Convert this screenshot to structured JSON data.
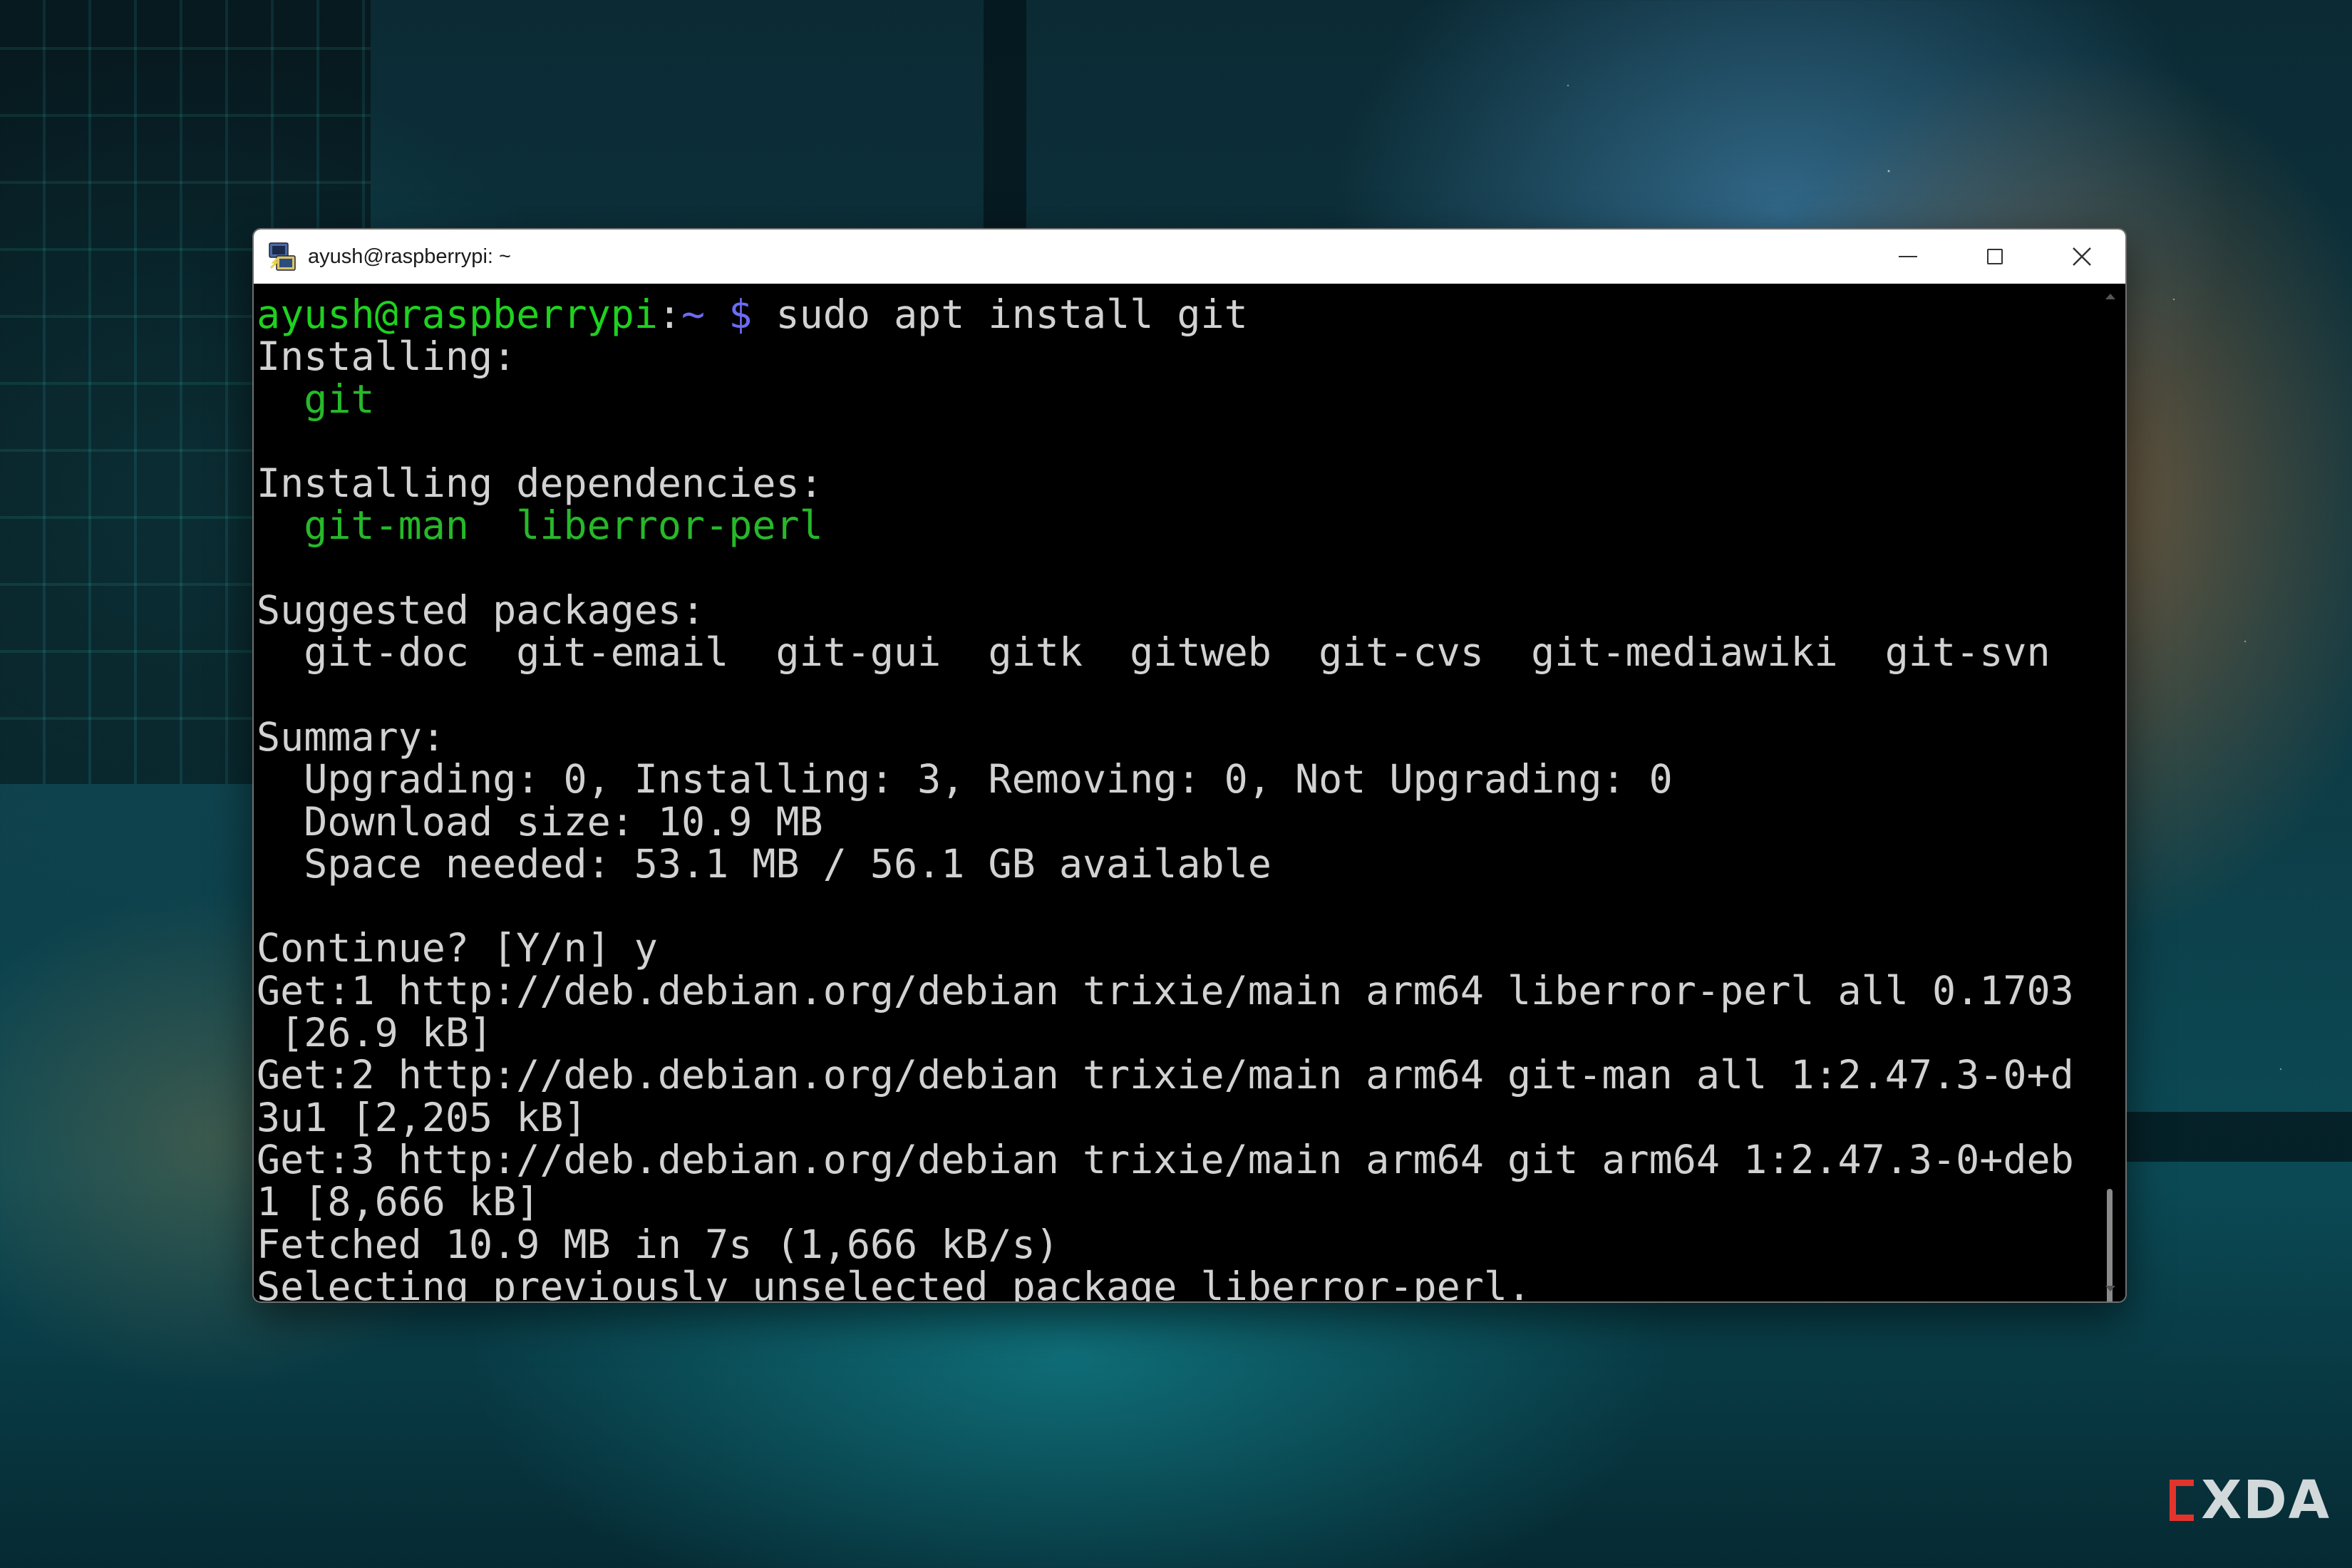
{
  "window": {
    "title": "ayush@raspberrypi: ~",
    "app_icon": "putty-terminal-icon"
  },
  "watermark": {
    "text": "XDA"
  },
  "terminal": {
    "prompt_user": "ayush@raspberrypi",
    "prompt_sep": ":",
    "prompt_path": "~ $",
    "command": " sudo apt install git",
    "lines": [
      "Installing:",
      "  ",
      "",
      "Installing dependencies:",
      "  ",
      "",
      "Suggested packages:",
      "  git-doc  git-email  git-gui  gitk  gitweb  git-cvs  git-mediawiki  git-svn",
      "",
      "Summary:",
      "  Upgrading: 0, Installing: 3, Removing: 0, Not Upgrading: 0",
      "  Download size: 10.9 MB",
      "  Space needed: 53.1 MB / 56.1 GB available",
      "",
      "Continue? [Y/n] y",
      "Get:1 http://deb.debian.org/debian trixie/main arm64 liberror-perl all 0.1703",
      " [26.9 kB]",
      "Get:2 http://deb.debian.org/debian trixie/main arm64 git-man all 1:2.47.3-0+d",
      "3u1 [2,205 kB]",
      "Get:3 http://deb.debian.org/debian trixie/main arm64 git arm64 1:2.47.3-0+deb",
      "1 [8,666 kB]",
      "Fetched 10.9 MB in 7s (1,666 kB/s)",
      "Selecting previously unselected package liberror-perl."
    ],
    "installing_pkg": "git",
    "dependency_pkgs": "git-man  liberror-perl"
  },
  "colors": {
    "prompt_user": "#1fd11f",
    "prompt_path": "#6b6bf5",
    "package_names": "#27b82a",
    "text": "#d2d2d2",
    "background": "#000000"
  }
}
